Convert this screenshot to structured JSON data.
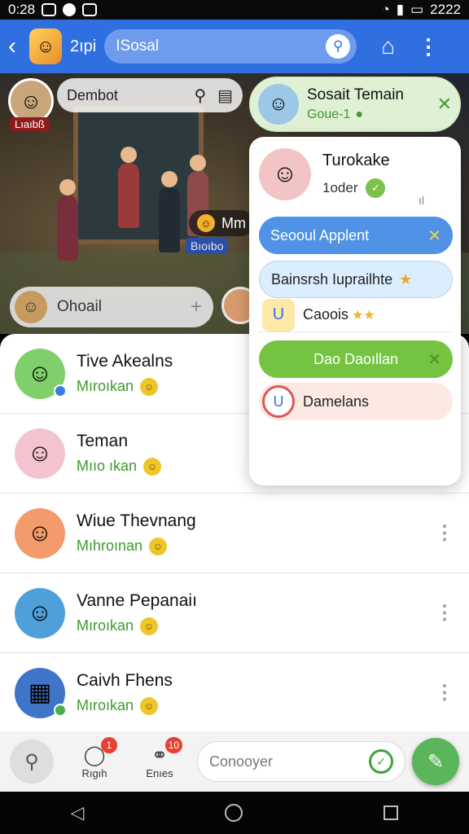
{
  "status_bar": {
    "time": "0:28",
    "right_time": "2222"
  },
  "app_bar": {
    "title": "2ıpi",
    "search_text": "ISosal",
    "icons": [
      "back-icon",
      "search-icon",
      "home-icon",
      "more-icon"
    ]
  },
  "scene": {
    "player_tag": "Lıaıbß",
    "search_text": "Dembot",
    "mini_label": "Mm",
    "mini_sub": "Bıoıbo",
    "chat_placeholder": "Ohoail"
  },
  "friend_popup": {
    "header_title": "Sosait Temain",
    "header_sub": "Goue-1",
    "card_name": "Turokake",
    "card_sub": "1oder",
    "card_signal": "ıl",
    "options": [
      {
        "label": "Seooul Applent",
        "style": "blue"
      },
      {
        "label": "Bainsrsh Iuprailhte",
        "style": "lightblue"
      },
      {
        "label": "Caoois",
        "style": "plain"
      },
      {
        "label": "Dao Daoıllan",
        "style": "green"
      },
      {
        "label": "Damelans",
        "style": "pink"
      }
    ]
  },
  "friends": [
    {
      "name": "Tive Akealns",
      "sub": "Mıroıkan",
      "avatar_color": "#7fcf6a"
    },
    {
      "name": "Teman",
      "sub": "Mııo ıkan",
      "avatar_color": "#f4c3d0"
    },
    {
      "name": "Wiue Thevnang",
      "sub": "Mıhroınan",
      "avatar_color": "#f39b6a"
    },
    {
      "name": "Vanne Pepanaiı",
      "sub": "Mıroıkan",
      "avatar_color": "#4fa0d8"
    },
    {
      "name": "Caivh Fhens",
      "sub": "Mıroıkan",
      "avatar_color": "#3f75c8"
    }
  ],
  "bottom_bar": {
    "item1_label": "Rıgıh",
    "item1_badge": "1",
    "item2_label": "Enıes",
    "item2_badge": "10",
    "input_placeholder": "Conooyer"
  }
}
